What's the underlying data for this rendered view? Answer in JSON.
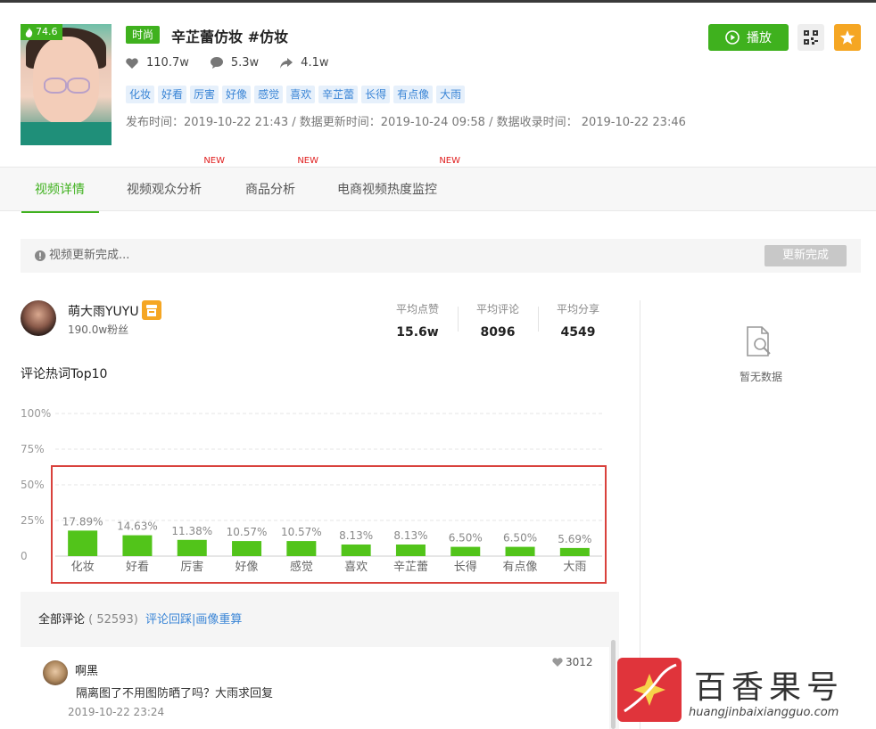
{
  "video": {
    "heat": "74.6",
    "category": "时尚",
    "title": "辛芷蕾仿妆 #仿妆",
    "likes": "110.7w",
    "comments": "5.3w",
    "shares": "4.1w",
    "tags": [
      "化妆",
      "好看",
      "厉害",
      "好像",
      "感觉",
      "喜欢",
      "辛芷蕾",
      "长得",
      "有点像",
      "大雨"
    ],
    "times": "发布时间：2019-10-22 21:43 / 数据更新时间：2019-10-24 09:58 / 数据收录时间： 2019-10-22 23:46"
  },
  "actions": {
    "play_label": "播放"
  },
  "tabs": [
    {
      "label": "视频详情",
      "new": ""
    },
    {
      "label": "视频观众分析",
      "new": "NEW"
    },
    {
      "label": "商品分析",
      "new": "NEW"
    },
    {
      "label": "电商视频热度监控",
      "new": "NEW"
    }
  ],
  "notice": {
    "text": "视频更新完成...",
    "button": "更新完成"
  },
  "author": {
    "name": "萌大雨YUYU",
    "fans": "190.0w粉丝",
    "avg": [
      {
        "label": "平均点赞",
        "value": "15.6w"
      },
      {
        "label": "平均评论",
        "value": "8096"
      },
      {
        "label": "平均分享",
        "value": "4549"
      }
    ]
  },
  "side": {
    "empty": "暂无数据"
  },
  "chart_title": "评论热词Top10",
  "chart_data": {
    "type": "bar",
    "categories": [
      "化妆",
      "好看",
      "厉害",
      "好像",
      "感觉",
      "喜欢",
      "辛芷蕾",
      "长得",
      "有点像",
      "大雨"
    ],
    "values": [
      17.89,
      14.63,
      11.38,
      10.57,
      10.57,
      8.13,
      8.13,
      6.5,
      6.5,
      5.69
    ],
    "data_labels": [
      "17.89%",
      "14.63%",
      "11.38%",
      "10.57%",
      "10.57%",
      "8.13%",
      "8.13%",
      "6.50%",
      "6.50%",
      "5.69%"
    ],
    "yticks": [
      "100%",
      "75%",
      "50%",
      "25%",
      "0"
    ],
    "ylim": [
      0,
      100
    ],
    "color": "#52c41a"
  },
  "comments": {
    "header": "全部评论",
    "count": "( 52593)",
    "link": "评论回踩|画像重算",
    "items": [
      {
        "user": "啊黑",
        "likes": "3012",
        "text": "隔离图了不用图防晒了吗？大雨求回复",
        "time": "2019-10-22 23:24"
      }
    ]
  },
  "watermark": {
    "title": "百香果号",
    "url": "huangjinbaixiangguo.com"
  }
}
